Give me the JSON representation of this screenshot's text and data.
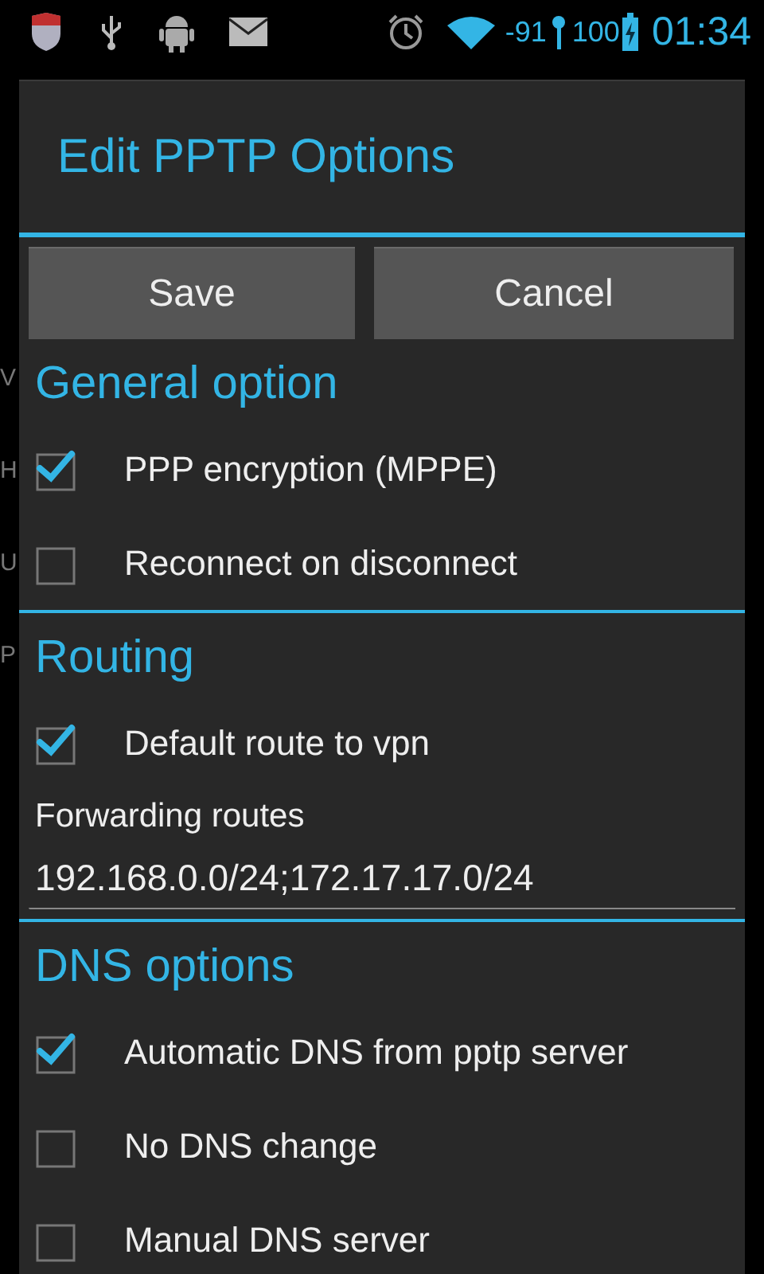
{
  "status_bar": {
    "signal": "-91",
    "battery": "100",
    "time": "01:34"
  },
  "background": {
    "labels": [
      "V",
      "H",
      "U",
      "P"
    ]
  },
  "dialog": {
    "title": "Edit PPTP Options",
    "buttons": [
      "Save",
      "Cancel"
    ],
    "sections": [
      {
        "title": "General option",
        "items": [
          {
            "kind": "checkbox",
            "label": "PPP encryption (MPPE)",
            "checked": true
          },
          {
            "kind": "checkbox",
            "label": "Reconnect on disconnect",
            "checked": false
          }
        ]
      },
      {
        "title": "Routing",
        "items": [
          {
            "kind": "checkbox",
            "label": "Default route to vpn",
            "checked": true
          },
          {
            "kind": "text_field",
            "label": "Forwarding routes",
            "value": "192.168.0.0/24;172.17.17.0/24"
          }
        ]
      },
      {
        "title": "DNS options",
        "items": [
          {
            "kind": "checkbox",
            "label": "Automatic DNS from pptp server",
            "checked": true
          },
          {
            "kind": "checkbox",
            "label": "No DNS change",
            "checked": false
          },
          {
            "kind": "checkbox",
            "label": "Manual DNS server",
            "checked": false
          }
        ]
      }
    ]
  }
}
